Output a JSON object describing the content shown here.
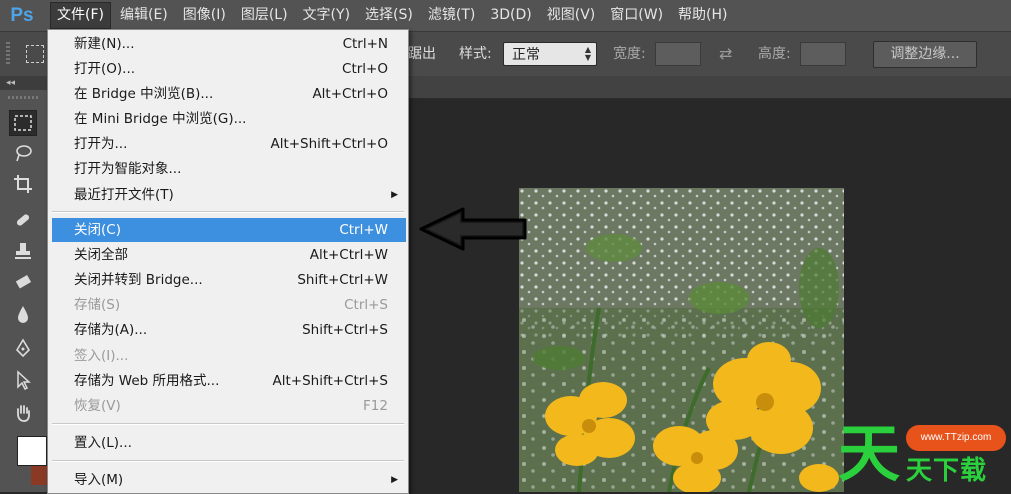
{
  "app": {
    "logo": "Ps"
  },
  "menubar": {
    "items": [
      "文件(F)",
      "编辑(E)",
      "图像(I)",
      "图层(L)",
      "文字(Y)",
      "选择(S)",
      "滤镜(T)",
      "3D(D)",
      "视图(V)",
      "窗口(W)",
      "帮助(H)"
    ]
  },
  "options": {
    "partial_label": "踞出",
    "style_label": "样式:",
    "style_value": "正常",
    "width_label": "宽度:",
    "height_label": "高度:",
    "refine_edge_button": "调整边缘..."
  },
  "toolbar": {
    "collapse_label": "◂◂",
    "icons": [
      "marquee-icon",
      "lasso-icon",
      "crop-icon",
      "healing-brush-icon",
      "stamp-icon",
      "eraser-icon",
      "blur-icon",
      "pen-icon",
      "path-select-icon",
      "hand-icon"
    ],
    "foreground_color": "#ffffff",
    "background_color": "#8a3a24"
  },
  "file_menu": {
    "items": [
      {
        "label": "新建(N)...",
        "shortcut": "Ctrl+N"
      },
      {
        "label": "打开(O)...",
        "shortcut": "Ctrl+O"
      },
      {
        "label": "在 Bridge 中浏览(B)...",
        "shortcut": "Alt+Ctrl+O"
      },
      {
        "label": "在 Mini Bridge 中浏览(G)...",
        "shortcut": ""
      },
      {
        "label": "打开为...",
        "shortcut": "Alt+Shift+Ctrl+O"
      },
      {
        "label": "打开为智能对象...",
        "shortcut": ""
      },
      {
        "label": "最近打开文件(T)",
        "shortcut": ""
      },
      {
        "label": "关闭(C)",
        "shortcut": "Ctrl+W"
      },
      {
        "label": "关闭全部",
        "shortcut": "Alt+Ctrl+W"
      },
      {
        "label": "关闭并转到 Bridge...",
        "shortcut": "Shift+Ctrl+W"
      },
      {
        "label": "存储(S)",
        "shortcut": "Ctrl+S"
      },
      {
        "label": "存储为(A)...",
        "shortcut": "Shift+Ctrl+S"
      },
      {
        "label": "签入(I)...",
        "shortcut": ""
      },
      {
        "label": "存储为 Web 所用格式...",
        "shortcut": "Alt+Shift+Ctrl+S"
      },
      {
        "label": "恢复(V)",
        "shortcut": "F12"
      },
      {
        "label": "置入(L)...",
        "shortcut": ""
      },
      {
        "label": "导入(M)",
        "shortcut": ""
      }
    ],
    "highlighted_item": "关闭(C)",
    "disabled_items": [
      "存储(S)",
      "签入(I)...",
      "恢复(V)"
    ],
    "highlight_color": "#3d8fe0"
  },
  "watermark": {
    "big_char": "天",
    "url": "www.TTzip.com",
    "sub_text": "天下载",
    "color": "#2bd13c",
    "badge_color": "#e8531c"
  }
}
